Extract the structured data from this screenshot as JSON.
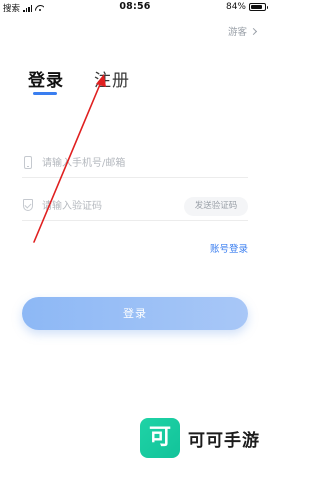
{
  "status_bar": {
    "carrier": "搜索",
    "time": "08:56",
    "battery": "84%",
    "battery_level": 0.84
  },
  "header": {
    "guest_label": "游客"
  },
  "tabs": [
    {
      "label": "登录",
      "active": true
    },
    {
      "label": "注册",
      "active": false
    }
  ],
  "form": {
    "phone_placeholder": "请输入手机号/邮箱",
    "code_placeholder": "请输入验证码",
    "send_code_label": "发送验证码",
    "account_login_label": "账号登录",
    "submit_label": "登录"
  },
  "brand": {
    "logo_char": "可",
    "name": "可可手游"
  },
  "colors": {
    "accent": "#3a7ef0",
    "brand_green": "#1fd3a6",
    "arrow": "#e02020"
  },
  "icons": [
    "signal-icon",
    "wifi-icon",
    "battery-icon",
    "chevron-right-icon",
    "phone-icon",
    "shield-check-icon"
  ]
}
